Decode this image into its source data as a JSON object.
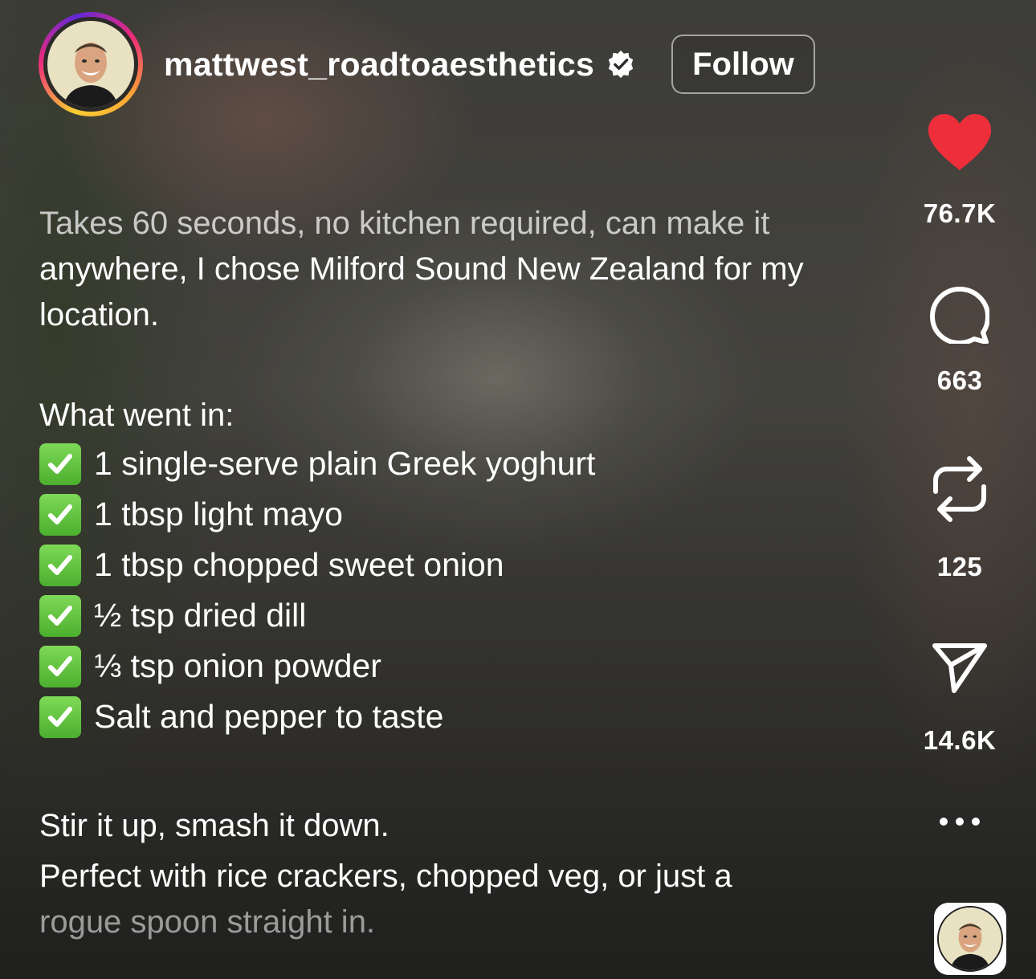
{
  "post": {
    "username": "mattwest_roadtoaesthetics",
    "verified": true,
    "follow_label": "Follow"
  },
  "caption": {
    "intro_lines": [
      "Takes 60 seconds, no kitchen required, can make it",
      "anywhere, I chose Milford Sound New Zealand for my",
      "location."
    ],
    "ingredients_heading": "What went in:",
    "ingredients": [
      "1 single-serve plain Greek yoghurt",
      "1 tbsp light mayo",
      "1 tbsp chopped sweet onion",
      "½ tsp dried dill",
      "⅓ tsp onion powder",
      "Salt and pepper to taste"
    ],
    "outro_lines": [
      "Stir it up, smash it down.",
      "Perfect with rice crackers, chopped veg, or just a",
      "rogue spoon straight in."
    ]
  },
  "actions": {
    "likes": "76.7K",
    "comments": "663",
    "reposts": "125",
    "shares": "14.6K"
  },
  "icons": {
    "like": "heart-icon",
    "comment": "comment-bubble-icon",
    "repost": "repost-icon",
    "share": "paper-plane-icon",
    "more": "more-dots-icon",
    "check": "green-checkmark-icon",
    "verified": "verified-badge-icon"
  },
  "colors": {
    "like_red": "#ee2e3b",
    "check_green": "#5fc13d",
    "verified_white": "#ffffff"
  }
}
